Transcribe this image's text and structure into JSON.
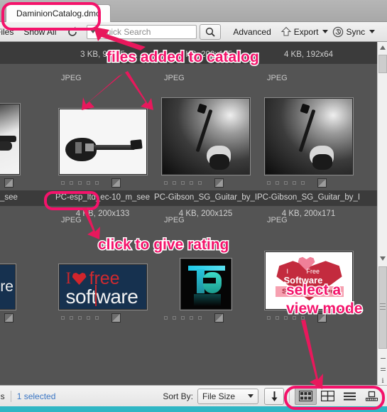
{
  "window": {
    "tab_label": "DaminionCatalog.dmc"
  },
  "toolbar": {
    "files_label": "Files",
    "show_all_label": "Show All",
    "refresh_icon": "refresh-icon",
    "search_placeholder": "Quick Search",
    "search_value": "",
    "search_icon": "magnifier-icon",
    "advanced_label": "Advanced",
    "export_label": "Export",
    "export_icon": "up-arrow-icon",
    "sync_label": "Sync",
    "sync_icon": "sync-circle-icon"
  },
  "browser": {
    "row_top": {
      "meta": [
        "3 KB, 95x95",
        "4 KB, 200x125",
        "4 KB, 192x64"
      ],
      "partial_meta_left": ""
    },
    "row_mid": {
      "format": [
        "JPEG",
        "JPEG",
        "JPEG"
      ],
      "format_left": "",
      "names": [
        "PC-esp_ltd_ec-10_m_see",
        "PC-Gibson_SG_Guitar_by_I",
        "PC-Gibson_SG_Guitar_by_I"
      ],
      "name_left": "_see",
      "meta_next": [
        "4 KB, 200x133",
        "4 KB, 200x125",
        "4 KB, 200x171"
      ]
    },
    "row_bottom": {
      "format": [
        "JPEG",
        "JPEG",
        "JPEG"
      ],
      "format_left": ""
    },
    "rating_stars_per_item": 5,
    "thumbnails": [
      {
        "caption": "",
        "kind": "guitar-white"
      },
      {
        "caption": "",
        "kind": "guitar-dark"
      },
      {
        "caption": "",
        "kind": "guitar-dark"
      },
      {
        "caption": "I ♥ free software",
        "kind": "free-software-logo"
      },
      {
        "caption": "TS",
        "kind": "ts-logo"
      },
      {
        "caption": "I Free Software Show Your Love!",
        "kind": "heart-logo"
      }
    ]
  },
  "logos": {
    "free_software": {
      "line1_pre": "I",
      "line1_post": "free",
      "line2": "software"
    },
    "ts": {
      "text": "TS"
    },
    "heart": {
      "small_i": "I",
      "small_free": "Free",
      "software": "Software",
      "ribbon": "Show Your Love!"
    }
  },
  "statusbar": {
    "items_label": "ns",
    "selected_label": "1 selected",
    "sort_by_label": "Sort By:",
    "sort_value": "File Size",
    "sort_direction_icon": "down-arrow-icon",
    "view_modes": [
      {
        "name": "thumbnail-grid-view",
        "icon": "grid-cells-icon",
        "active": true
      },
      {
        "name": "grid-view",
        "icon": "grid-icon",
        "active": false
      },
      {
        "name": "list-view",
        "icon": "lines-icon",
        "active": false
      },
      {
        "name": "filmstrip-view",
        "icon": "filmstrip-icon",
        "active": false
      }
    ]
  },
  "annotations": [
    {
      "name": "files-added-to-catalog",
      "text": "files added to catalog"
    },
    {
      "name": "click-to-give-rating",
      "text": "click to give rating"
    },
    {
      "name": "select-a-view-mode-line1",
      "text": "select a"
    },
    {
      "name": "select-a-view-mode-line2",
      "text": "view mode"
    }
  ],
  "colors": {
    "accent_pink": "#f4136b",
    "panel_dark": "#3b3b3b",
    "panel_mid": "#545454",
    "link_blue": "#3b76c4",
    "footer_teal": "#2fb6c4"
  }
}
